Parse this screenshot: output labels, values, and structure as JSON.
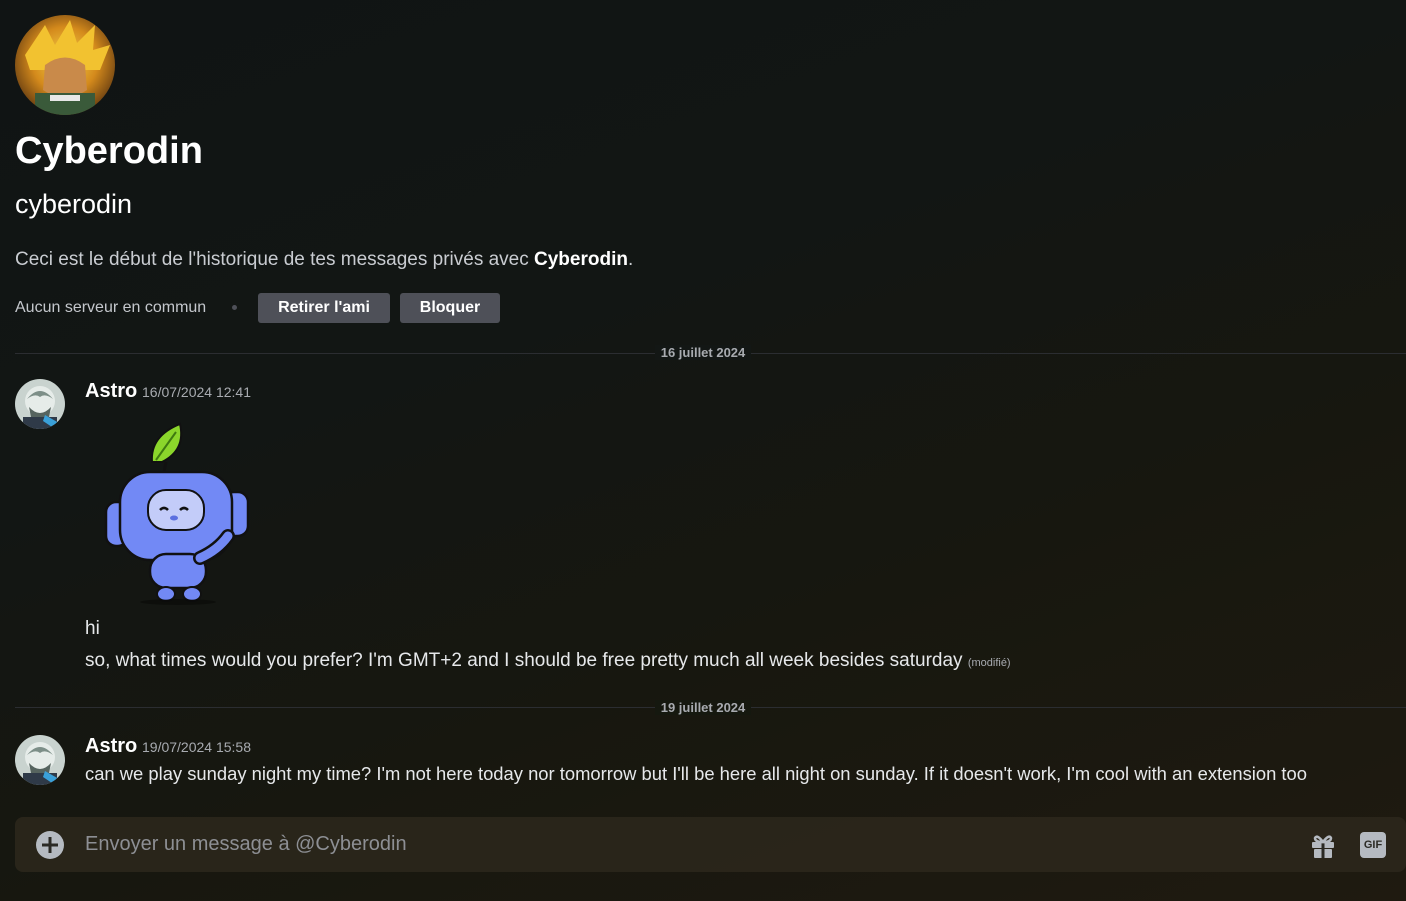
{
  "profile": {
    "display_name": "Cyberodin",
    "username": "cyberodin",
    "intro_prefix": "Ceci est le début de l'historique de tes messages privés avec ",
    "intro_name": "Cyberodin",
    "intro_suffix": ".",
    "common_servers": "Aucun serveur en commun",
    "remove_friend_label": "Retirer l'ami",
    "block_label": "Bloquer",
    "avatar_icon": "profile-avatar-golden-warrior"
  },
  "messages": [
    {
      "date_divider": "16 juillet 2024",
      "author": "Astro",
      "timestamp": "16/07/2024 12:41",
      "sticker_icon": "wumpus-leaf-sticker",
      "lines": [
        {
          "text": "hi",
          "edited": ""
        },
        {
          "text": "so, what times would you prefer? I'm GMT+2 and I should be free pretty much all week besides saturday",
          "edited": "(modifié)"
        }
      ]
    },
    {
      "date_divider": "19 juillet 2024",
      "author": "Astro",
      "timestamp": "19/07/2024 15:58",
      "lines": [
        {
          "text": "can we play sunday night my time? I'm not here today nor tomorrow but I'll be here all night on sunday. If it doesn't work, I'm cool with an extension too",
          "edited": ""
        }
      ]
    }
  ],
  "composer": {
    "placeholder": "Envoyer un message à @Cyberodin",
    "gif_label": "GIF"
  },
  "colors": {
    "button_bg": "#4e5058",
    "text_muted": "#a8abb0",
    "wumpus_blue": "#7289f5",
    "leaf_green": "#8bd62b"
  }
}
